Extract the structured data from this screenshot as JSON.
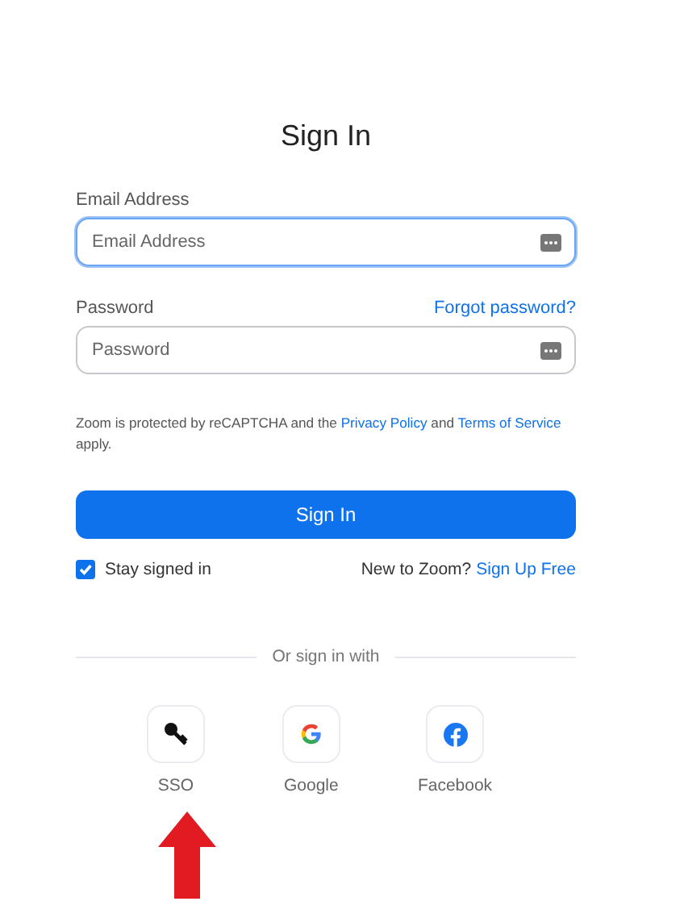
{
  "title": "Sign In",
  "fields": [
    {
      "label": "Email Address",
      "placeholder": "Email Address",
      "focused": true
    },
    {
      "label": "Password",
      "placeholder": "Password",
      "focused": false,
      "link": "Forgot password?"
    }
  ],
  "notice": {
    "before": "Zoom is protected by reCAPTCHA and the ",
    "link1": "Privacy Policy",
    "middle": " and ",
    "link2": "Terms of Service",
    "after": " apply."
  },
  "submit": "Sign In",
  "stay_signed_in": {
    "label": "Stay signed in",
    "checked": true
  },
  "signup": {
    "text": "New to Zoom?",
    "link": "Sign Up Free"
  },
  "divider": "Or sign in with",
  "social": [
    {
      "kind": "key",
      "label": "SSO"
    },
    {
      "kind": "google",
      "label": "Google"
    },
    {
      "kind": "facebook",
      "label": "Facebook"
    }
  ]
}
